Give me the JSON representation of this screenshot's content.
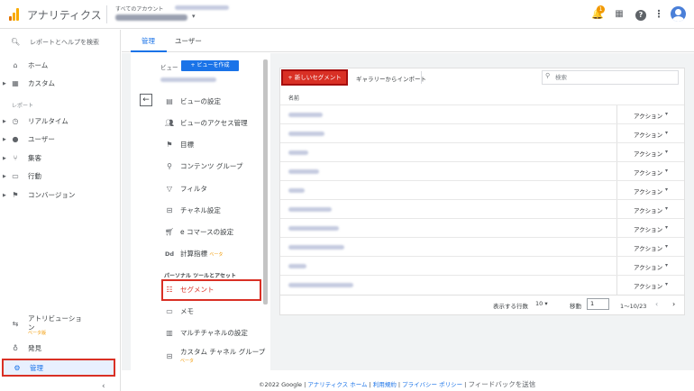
{
  "app_title": "アナリティクス",
  "account_label": "すべてのアカウント",
  "topbar": {
    "notification_count": "1"
  },
  "sidebar": {
    "search_label": "レポートとヘルプを検索",
    "home": "ホーム",
    "custom": "カスタム",
    "reports_header": "レポート",
    "realtime": "リアルタイム",
    "users": "ユーザー",
    "acquisition": "集客",
    "behavior": "行動",
    "conversions": "コンバージョン",
    "attribution": "アトリビューション",
    "attribution_beta": "ベータ版",
    "discover": "発見",
    "admin": "管理"
  },
  "tabs": {
    "manage": "管理",
    "user": "ユーザー"
  },
  "view_column": {
    "view_label": "ビュー",
    "create_view": "+ ビューを作成",
    "items": [
      "ビューの設定",
      "ビューのアクセス管理",
      "目標",
      "コンテンツ グループ",
      "フィルタ",
      "チャネル設定",
      "e コマースの設定",
      "計算指標"
    ],
    "calc_beta": "ベータ",
    "personal_header": "パーソナル ツールとアセット",
    "segments": "セグメント",
    "memo": "メモ",
    "multichannel": "マルチチャネルの設定",
    "custom_channel": "カスタム チャネル グループ",
    "custom_channel_beta": "ベータ"
  },
  "segments_panel": {
    "new_segment": "+ 新しいセグメント",
    "import": "ギャラリーからインポート",
    "search_placeholder": "検索",
    "name_header": "名前",
    "action_label": "アクション",
    "row_count": 10,
    "rows_label": "表示する行数",
    "rows_value": "10",
    "goto_label": "移動",
    "goto_value": "1",
    "range": "1～10/23"
  },
  "footer": {
    "copyright": "©2022 Google",
    "home_link": "アナリティクス ホーム",
    "terms": "利用規約",
    "privacy": "プライバシー ポリシー",
    "feedback": "フィードバックを送信"
  },
  "colors": {
    "accent": "#1a73e8",
    "highlight_red": "#d93025",
    "logo_orange": "#f29900"
  }
}
